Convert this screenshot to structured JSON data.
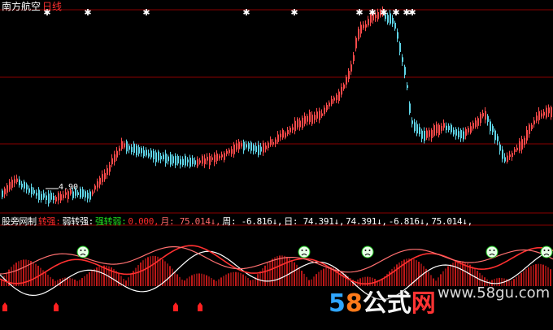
{
  "window": {
    "stock_name": "南方航空",
    "period": "日线"
  },
  "price_panel": {
    "low_label": "4.90"
  },
  "indicator_legend": [
    {
      "text": "股旁网制",
      "color": "#ffffff"
    },
    {
      "text": "转强:",
      "color": "#ff2a2a"
    },
    {
      "text": "弱转强:",
      "color": "#ffffff"
    },
    {
      "text": "强转弱:",
      "color": "#20e020"
    },
    {
      "text": "0.000,",
      "color": "#ff2a2a"
    },
    {
      "text": "月: 75.014↓,",
      "color": "#ff6a6a"
    },
    {
      "text": "周: -6.816↓,",
      "color": "#ffffff"
    },
    {
      "text": "日: 74.391↓,",
      "color": "#ffffff"
    },
    {
      "text": "74.391↓,",
      "color": "#ffffff"
    },
    {
      "text": "-6.816↓,",
      "color": "#ffffff"
    },
    {
      "text": "75.014↓,",
      "color": "#ffffff"
    }
  ],
  "watermark": {
    "digit_5": "5",
    "digit_8": "8",
    "word": "公式",
    "wang": "网",
    "url": "www.58gu.com"
  },
  "colors": {
    "up": "#ff4a4a",
    "down": "#5fd5e8",
    "grid": "#8a0000",
    "signal": "#ff2020"
  },
  "icons": {
    "top_marker": "star-icon",
    "face_marker": "frown-face-icon",
    "bottom_marker": "arrow-up-marker-icon"
  }
}
